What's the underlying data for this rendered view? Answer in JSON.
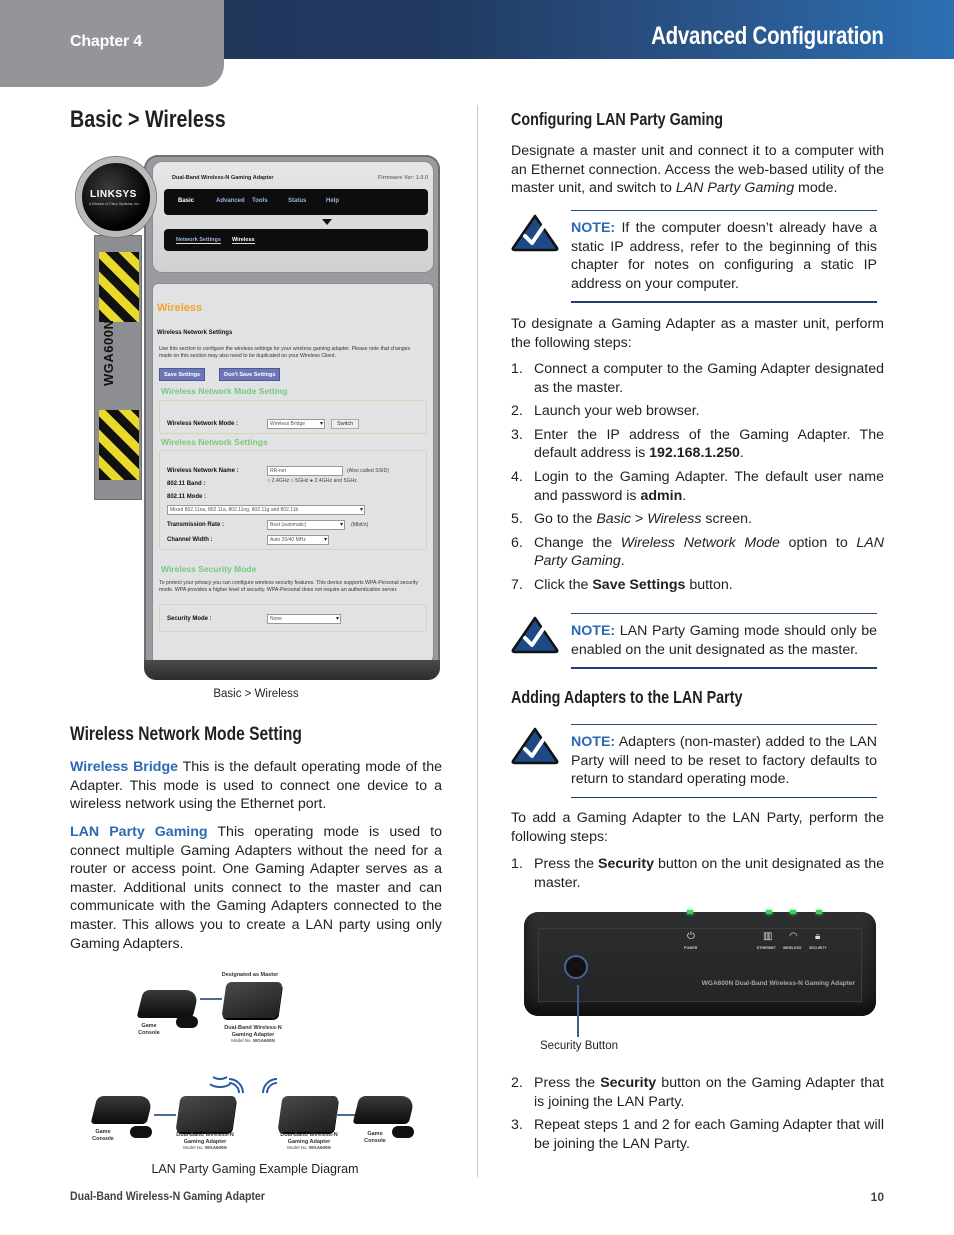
{
  "header": {
    "chapter": "Chapter 4",
    "title": "Advanced Configuration"
  },
  "left": {
    "heading": "Basic > Wireless",
    "screenshot": {
      "logo": "LINKSYS",
      "logo_sub": "A Division of Cisco Systems, Inc.",
      "model_banner": "WGA600N",
      "product": "Dual-Band Wireless-N Gaming Adapter",
      "firmware": "Firmware Ver: 1.0.0",
      "nav": [
        "Basic",
        "Advanced",
        "Tools",
        "Status",
        "Help"
      ],
      "subnav": [
        "Network Settings",
        "Wireless"
      ],
      "page_title": "Wireless",
      "section_title": "Wireless Network Settings",
      "intro": "Use this section to configure the wireless settings for your wireless gaming adapter. Please note that changes made on this section may also need to be duplicated on your Wireless Client.",
      "save_button": "Save Settings",
      "dont_save_button": "Don't Save Settings",
      "mode_heading": "Wireless Network Mode Setting",
      "mode_label": "Wireless Network Mode :",
      "mode_value": "Wireless Bridge",
      "switch_button": "Switch",
      "net_heading": "Wireless Network Settings",
      "ssid_label": "Wireless Network Name :",
      "ssid_value": "RR-net",
      "ssid_note": "(Also called SSID)",
      "band_label": "802.11 Band :",
      "band_options": [
        "2.4GHz",
        "5GHz",
        "2.4GHz and 5GHz"
      ],
      "band_selected": "2.4GHz and 5GHz",
      "mode11_label": "802.11 Mode :",
      "mode11_value": "Mixed 802.11na, 802.11a, 802.11ng, 802.11g and 802.11b",
      "rate_label": "Transmission Rate :",
      "rate_value": "Best (automatic)",
      "rate_unit": "(Mbit/s)",
      "width_label": "Channel Width :",
      "width_value": "Auto 20/40 MHz",
      "sec_heading": "Wireless Security Mode",
      "sec_intro": "To protect your privacy you can configure wireless security features. This device supports WPA-Personal security mode. WPA provides a higher level of security. WPA-Personal does not require an authentication server.",
      "sec_label": "Security Mode :",
      "sec_value": "None"
    },
    "screenshot_caption": "Basic > Wireless",
    "mode_section_heading": "Wireless Network Mode Setting",
    "bridge_term": "Wireless Bridge",
    "bridge_text": " This is the default operating mode of the Adapter. This mode is used to connect one device to a wireless network using the Ethernet port.",
    "lan_term": "LAN Party Gaming",
    "lan_text": " This operating mode is used to connect multiple Gaming Adapters without the need for a router or access point. One Gaming Adapter serves as a master. Additional units connect to the master and can communicate with the Gaming Adapters connected to the master. This allows you to create a LAN party using only Gaming Adapters.",
    "diagram": {
      "master_label": "Designated as Master",
      "adapter_label_1": "Dual-Band Wireless-N",
      "adapter_label_2": "Gaming Adapter",
      "model_prefix": "Model No.",
      "model": "WGA600N",
      "console_label_1": "Game",
      "console_label_2": "Console"
    },
    "diagram_caption": "LAN Party Gaming Example Diagram"
  },
  "right": {
    "config_heading": "Configuring LAN Party Gaming",
    "config_para_1": "Designate a master unit and connect it to a computer with an Ethernet connection. Access the web-based utility of the master unit, and switch to ",
    "config_para_em": "LAN Party Gaming",
    "config_para_2": " mode.",
    "note_label": "NOTE:",
    "note1": " If the computer doesn’t already have a static IP address, refer to the beginning of this chapter for notes on configuring a static IP address on your computer.",
    "designate_intro": "To designate a Gaming Adapter as a master unit, perform the following steps:",
    "steps1": [
      {
        "n": "1.",
        "parts": [
          {
            "t": "Connect a computer to the Gaming Adapter designated as the master."
          }
        ]
      },
      {
        "n": "2.",
        "parts": [
          {
            "t": "Launch your web browser."
          }
        ]
      },
      {
        "n": "3.",
        "parts": [
          {
            "t": "Enter the IP address of the Gaming Adapter. The default address is "
          },
          {
            "t": "192.168.1.250",
            "b": true
          },
          {
            "t": "."
          }
        ]
      },
      {
        "n": "4.",
        "parts": [
          {
            "t": "Login to the Gaming Adapter. The default user name and password is "
          },
          {
            "t": "admin",
            "b": true
          },
          {
            "t": "."
          }
        ]
      },
      {
        "n": "5.",
        "parts": [
          {
            "t": "Go to the "
          },
          {
            "t": "Basic",
            "i": true
          },
          {
            "t": " > "
          },
          {
            "t": "Wireless",
            "i": true
          },
          {
            "t": " screen."
          }
        ]
      },
      {
        "n": "6.",
        "parts": [
          {
            "t": "Change the "
          },
          {
            "t": "Wireless Network Mode",
            "i": true
          },
          {
            "t": " option to "
          },
          {
            "t": "LAN Party Gaming",
            "i": true
          },
          {
            "t": "."
          }
        ]
      },
      {
        "n": "7.",
        "parts": [
          {
            "t": "Click the "
          },
          {
            "t": "Save Settings",
            "b": true
          },
          {
            "t": " button."
          }
        ]
      }
    ],
    "note2": " LAN Party Gaming mode should only be enabled on the unit designated as the master.",
    "adding_heading": "Adding Adapters to the LAN Party",
    "note3": " Adapters (non-master) added to the LAN Party will need to be reset to factory defaults to return to standard operating mode.",
    "add_intro": "To add a Gaming Adapter to the LAN Party, perform the following steps:",
    "steps2a": [
      {
        "n": "1.",
        "parts": [
          {
            "t": "Press the "
          },
          {
            "t": "Security",
            "b": true
          },
          {
            "t": " button on the unit designated as the master."
          }
        ]
      }
    ],
    "device": {
      "power": "POWER",
      "ethernet": "ETHERNET",
      "wireless": "WIRELESS",
      "security": "SECURITY",
      "model_text": "WGA600N Dual-Band Wireless-N Gaming Adapter",
      "callout": "Security Button"
    },
    "steps2b": [
      {
        "n": "2.",
        "parts": [
          {
            "t": "Press the "
          },
          {
            "t": "Security",
            "b": true
          },
          {
            "t": " button on the Gaming Adapter that is joining the LAN Party."
          }
        ]
      },
      {
        "n": "3.",
        "parts": [
          {
            "t": "Repeat steps 1 and 2 for each Gaming Adapter that will be joining the LAN Party."
          }
        ]
      }
    ]
  },
  "footer": {
    "product": "Dual-Band Wireless-N Gaming Adapter",
    "page": "10"
  },
  "colors": {
    "accent_blue": "#2a6ab3",
    "header_dark": "#1f3459",
    "chapter_tab_gray": "#939598"
  }
}
